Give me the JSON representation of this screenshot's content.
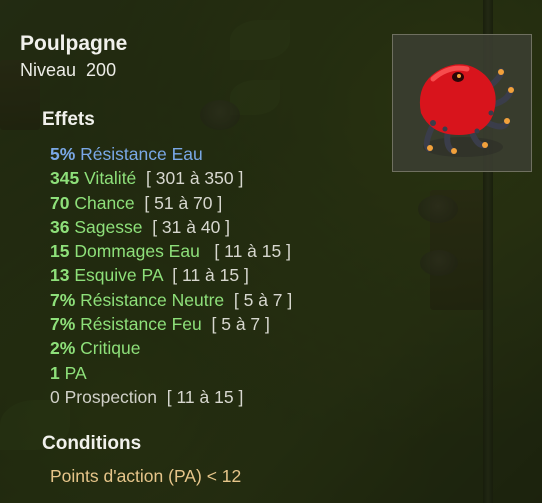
{
  "item": {
    "name": "Poulpagne",
    "level_label": "Niveau",
    "level_value": "200",
    "image_icon": "red-octopus-item-icon"
  },
  "effects": {
    "title": "Effets",
    "lines": [
      {
        "value": "5%",
        "label": "Résistance Eau",
        "range": "",
        "color": "#7aa8e6"
      },
      {
        "value": "345",
        "label": "Vitalité",
        "range": "[ 301 à 350 ]",
        "color": "#8ee07a"
      },
      {
        "value": "70",
        "label": "Chance",
        "range": "[ 51 à 70 ]",
        "color": "#8ee07a"
      },
      {
        "value": "36",
        "label": "Sagesse",
        "range": "[ 31 à 40 ]",
        "color": "#8ee07a"
      },
      {
        "value": "15",
        "label": "Dommages Eau",
        "range": "[ 11 à 15 ]",
        "color": "#8ee07a"
      },
      {
        "value": "13",
        "label": "Esquive PA",
        "range": "[ 11 à 15 ]",
        "color": "#8ee07a"
      },
      {
        "value": "7%",
        "label": "Résistance Neutre",
        "range": "[ 5 à 7 ]",
        "color": "#8ee07a"
      },
      {
        "value": "7%",
        "label": "Résistance Feu",
        "range": "[ 5 à 7 ]",
        "color": "#8ee07a"
      },
      {
        "value": "2%",
        "label": "Critique",
        "range": "",
        "color": "#8ee07a"
      },
      {
        "value": "1",
        "label": "PA",
        "range": "",
        "color": "#8ee07a"
      },
      {
        "value": "0",
        "label": "Prospection",
        "range": "[ 11 à 15 ]",
        "color": "#d0d0c8"
      }
    ]
  },
  "conditions": {
    "title": "Conditions",
    "text": "Points d'action (PA) < 12",
    "color": "#e6c58a"
  }
}
